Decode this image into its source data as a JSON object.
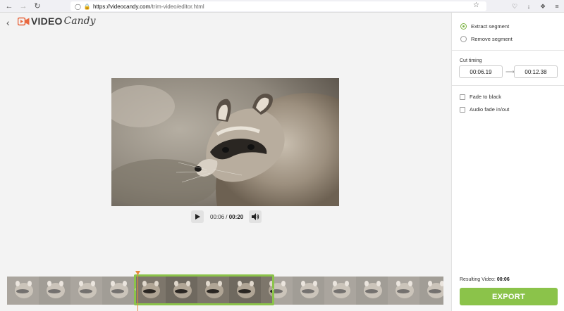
{
  "browser": {
    "url_host": "https://videocandy.com",
    "url_path": "/trim-video/editor.html"
  },
  "app": {
    "logo_part1": "VIDEO",
    "logo_part2": "Candy",
    "brand_color": "#e8683f"
  },
  "player": {
    "current_time": "00:06",
    "separator": " / ",
    "duration": "00:20"
  },
  "panel": {
    "mode_options": [
      {
        "label": "Extract segment",
        "selected": true
      },
      {
        "label": "Remove segment",
        "selected": false
      }
    ],
    "cut_timing_label": "Cut timing",
    "start_time": "00:06.19",
    "end_time": "00:12.38",
    "options": [
      {
        "label": "Fade to black",
        "checked": false
      },
      {
        "label": "Audio fade in/out",
        "checked": false
      }
    ],
    "resulting_label": "Resulting Video:",
    "resulting_value": "00:06",
    "export_label": "EXPORT",
    "accent_color": "#8bc34a"
  },
  "timeline": {
    "selection_start_s": 6.19,
    "selection_end_s": 12.38,
    "playhead_s": 6.19
  }
}
